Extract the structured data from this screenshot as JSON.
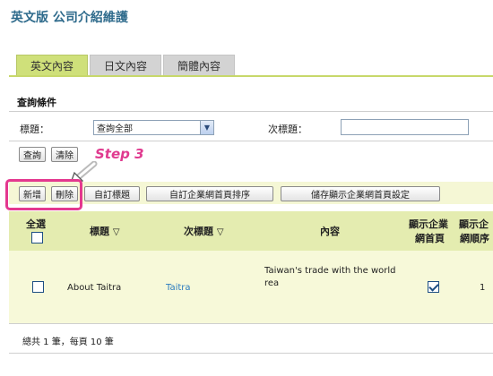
{
  "page": {
    "title": "英文版 公司介紹維護"
  },
  "tabs": [
    {
      "label": "英文內容",
      "active": true
    },
    {
      "label": "日文內容",
      "active": false
    },
    {
      "label": "簡體內容",
      "active": false
    }
  ],
  "search": {
    "section_title": "查詢條件",
    "title_label": "標題：",
    "title_select_value": "查詢全部",
    "subtitle_label": "次標題：",
    "subtitle_value": "",
    "query_button": "查詢",
    "clear_button": "清除"
  },
  "annotation": {
    "step_label": "Step 3",
    "color": "#e03a8f"
  },
  "toolbar": {
    "add": "新增",
    "delete": "刪除",
    "custom_title": "自訂標題",
    "custom_sort": "自訂企業網首頁排序",
    "save_display": "儲存顯示企業網首頁設定"
  },
  "table": {
    "columns": {
      "select_all": "全選",
      "title": "標題",
      "subtitle": "次標題",
      "content": "內容",
      "show_homepage_1": "顯示企業",
      "show_homepage_2": "網首頁",
      "show_order_1": "顯示企",
      "show_order_2": "網順序"
    },
    "rows": [
      {
        "selected": false,
        "title": "About Taitra",
        "subtitle": "Taitra",
        "content_line1": "Taiwan's trade with the world",
        "content_line2": "rea",
        "show_on_homepage": true,
        "order": "1"
      }
    ],
    "footer": "總共 1 筆，每頁 10 筆"
  },
  "colors": {
    "title": "#2f6b8c",
    "tab_active": "#cfe07a",
    "tab_inactive": "#d3d3d3",
    "header_row": "#e4ecb0",
    "data_row": "#f7f9d9",
    "link": "#2b7bbf",
    "highlight": "#e4388f"
  }
}
